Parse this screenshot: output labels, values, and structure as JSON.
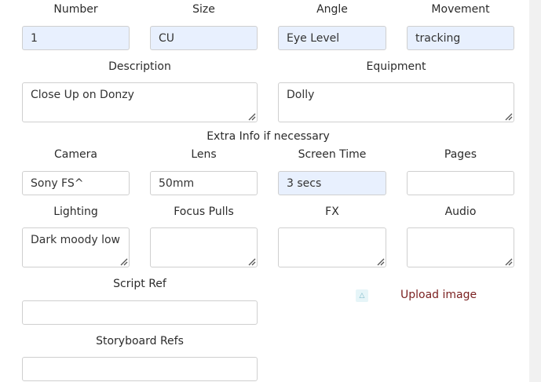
{
  "labels": {
    "number": "Number",
    "size": "Size",
    "angle": "Angle",
    "movement": "Movement",
    "description": "Description",
    "equipment": "Equipment",
    "extra_info": "Extra Info if necessary",
    "camera": "Camera",
    "lens": "Lens",
    "screen_time": "Screen Time",
    "pages": "Pages",
    "lighting": "Lighting",
    "focus_pulls": "Focus Pulls",
    "fx": "FX",
    "audio": "Audio",
    "script_ref": "Script Ref",
    "storyboard_refs": "Storyboard Refs"
  },
  "values": {
    "number": "1",
    "size": "CU",
    "angle": "Eye Level",
    "movement": "tracking",
    "description": "Close Up on Donzy",
    "equipment": "Dolly",
    "camera": "Sony FS^",
    "lens": "50mm",
    "screen_time": "3 secs",
    "pages": "",
    "lighting": "Dark moody low",
    "focus_pulls": "",
    "fx": "",
    "audio": "",
    "script_ref": "",
    "storyboard_refs": ""
  },
  "upload": {
    "label": "Upload image",
    "icon": "upload-icon"
  }
}
